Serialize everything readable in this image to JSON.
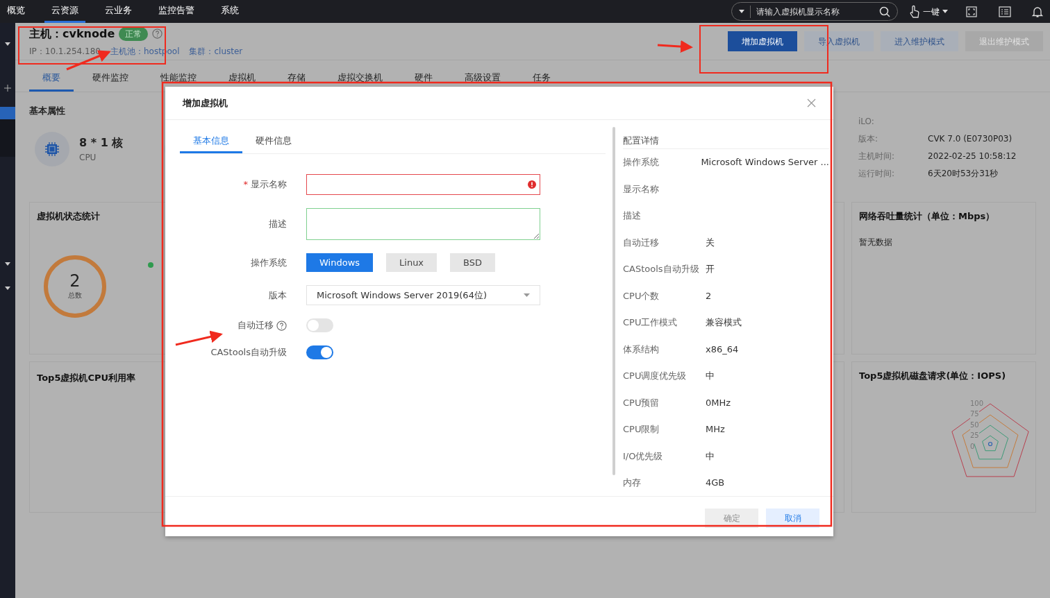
{
  "top_nav": {
    "items": [
      {
        "label": "概览",
        "selected": false
      },
      {
        "label": "云资源",
        "selected": true
      },
      {
        "label": "云业务",
        "selected": false
      },
      {
        "label": "监控告警",
        "selected": false
      },
      {
        "label": "系统",
        "selected": false
      }
    ],
    "search": {
      "placeholder": "请输入虚拟机显示名称"
    },
    "one_key": "一键"
  },
  "host": {
    "title": "主机：cvknode",
    "status": "正常",
    "ip": "IP：10.1.254.180",
    "pool": "主机池：hostpool",
    "cluster": "集群：cluster"
  },
  "actions": [
    {
      "label": "增加虚拟机",
      "kind": "primary"
    },
    {
      "label": "导入虚拟机",
      "kind": "normal"
    },
    {
      "label": "进入维护模式",
      "kind": "normal"
    },
    {
      "label": "退出维护模式",
      "kind": "disabled"
    }
  ],
  "tabs": [
    {
      "label": "概要",
      "selected": true
    },
    {
      "label": "硬件监控",
      "selected": false
    },
    {
      "label": "性能监控",
      "selected": false
    },
    {
      "label": "虚拟机",
      "selected": false
    },
    {
      "label": "存储",
      "selected": false
    },
    {
      "label": "虚拟交换机",
      "selected": false
    },
    {
      "label": "硬件",
      "selected": false
    },
    {
      "label": "高级设置",
      "selected": false
    },
    {
      "label": "任务",
      "selected": false
    }
  ],
  "basic": {
    "title": "基本属性",
    "cpu_value": "8 * 1 核",
    "cpu_label": "CPU"
  },
  "info": [
    {
      "label": "iLO:"
    },
    {
      "label": "版本:",
      "value": "CVK 7.0 (E0730P03)"
    },
    {
      "label": "主机时间:",
      "value": "2022-02-25 10:58:12"
    },
    {
      "label": "运行时间:",
      "value": "6天20时53分31秒"
    }
  ],
  "cards": {
    "vm_status": {
      "title": "虚拟机状态统计",
      "total": "2",
      "total_label": "总数"
    },
    "network": {
      "title": "网络吞吐量统计（单位：Mbps）",
      "empty": "暂无数据"
    },
    "cpu_top": {
      "title": "Top5虚拟机CPU利用率"
    },
    "disk_top": {
      "title": "Top5虚拟机磁盘请求(单位：IOPS)",
      "ticks": [
        "100",
        "75",
        "50",
        "25",
        "0"
      ]
    }
  },
  "dialog": {
    "title": "增加虚拟机",
    "tabs": [
      {
        "label": "基本信息",
        "selected": true
      },
      {
        "label": "硬件信息",
        "selected": false
      }
    ],
    "fields": [
      {
        "kind": "text",
        "label": "显示名称",
        "required_mark": "*",
        "error": true
      },
      {
        "kind": "textarea",
        "label": "描述",
        "error": false
      },
      {
        "kind": "segmented",
        "label": "操作系统",
        "options": [
          {
            "label": "Windows",
            "selected": true
          },
          {
            "label": "Linux",
            "selected": false
          },
          {
            "label": "BSD",
            "selected": false
          }
        ]
      },
      {
        "kind": "select",
        "label": "版本",
        "value": "Microsoft Windows Server 2019(64位)"
      },
      {
        "kind": "switch",
        "label": "自动迁移",
        "help": true,
        "on": false
      },
      {
        "kind": "switch",
        "label": "CAStools自动升级",
        "help": false,
        "on": true
      }
    ],
    "summary_title": "配置详情",
    "summary": [
      {
        "label": "操作系统",
        "value": "Microsoft Windows Server ..."
      },
      {
        "label": "显示名称"
      },
      {
        "label": "描述"
      },
      {
        "label": "自动迁移",
        "value": "关"
      },
      {
        "label": "CAStools自动升级",
        "value": "开"
      },
      {
        "label": "CPU个数",
        "value": "2"
      },
      {
        "label": "CPU工作模式",
        "value": "兼容模式"
      },
      {
        "label": "体系结构",
        "value": "x86_64"
      },
      {
        "label": "CPU调度优先级",
        "value": "中"
      },
      {
        "label": "CPU预留",
        "value": "0MHz"
      },
      {
        "label": "CPU限制",
        "value": "MHz"
      },
      {
        "label": "I/O优先级",
        "value": "中"
      },
      {
        "label": "内存",
        "value": "4GB"
      }
    ],
    "buttons": [
      {
        "label": "确定",
        "disabled": true
      },
      {
        "label": "取消",
        "disabled": false
      }
    ]
  }
}
